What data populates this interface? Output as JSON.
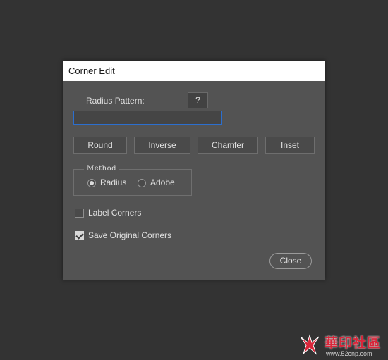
{
  "dialog": {
    "title": "Corner Edit",
    "radius_pattern_label": "Radius Pattern:",
    "help_label": "?",
    "radius_input": {
      "value": "",
      "placeholder": ""
    },
    "buttons": {
      "round": "Round",
      "inverse": "Inverse",
      "chamfer": "Chamfer",
      "inset": "Inset"
    },
    "method": {
      "legend": "Method",
      "options": [
        {
          "label": "Radius",
          "checked": true
        },
        {
          "label": "Adobe",
          "checked": false
        }
      ]
    },
    "checkboxes": {
      "label_corners": {
        "label": "Label Corners",
        "checked": false
      },
      "save_original_corners": {
        "label": "Save Original Corners",
        "checked": true
      }
    },
    "close_label": "Close"
  },
  "colors": {
    "background": "#333333",
    "dialog_bg": "#535353",
    "titlebar_bg": "#ffffff",
    "input_focus_border": "#2c6fcf",
    "watermark_red": "#d9263a"
  },
  "watermark": {
    "text": "華印社區",
    "url": "www.52cnp.com"
  }
}
